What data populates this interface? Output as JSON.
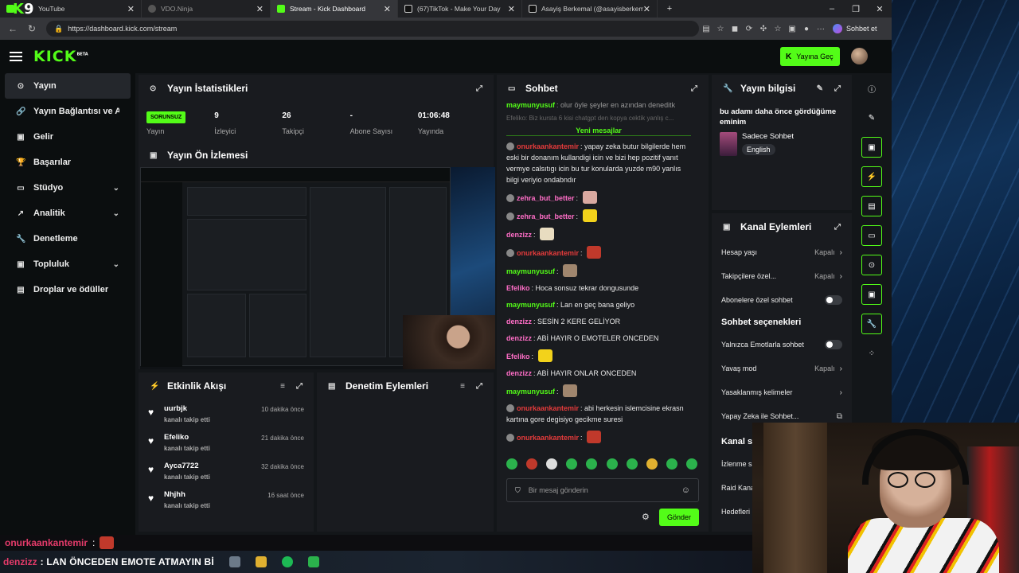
{
  "browser": {
    "tabs": [
      {
        "title": "YouTube",
        "color": "#ff0000"
      },
      {
        "title": "VDO.Ninja",
        "color": "#777777"
      },
      {
        "title": "Stream - Kick Dashboard",
        "color": "#53fc18"
      },
      {
        "title": "(67)TikTok - Make Your Day",
        "color": "#ffffff"
      },
      {
        "title": "Asayiş Berkemal (@asayisberkemal",
        "color": "#ffffff"
      }
    ],
    "url": "https://dashboard.kick.com/stream",
    "sohbet_et": "Sohbet et",
    "overlay_badge": "9"
  },
  "header": {
    "logo": "KICK",
    "logo_sup": "BETA",
    "go_live": "Yayına Geç"
  },
  "sidebar": {
    "items": [
      {
        "label": "Yayın",
        "icon": "target-icon",
        "active": true,
        "chevron": false
      },
      {
        "label": "Yayın Bağlantısı ve Anahtarı",
        "icon": "link-icon",
        "chevron": false
      },
      {
        "label": "Gelir",
        "icon": "wallet-icon",
        "chevron": false
      },
      {
        "label": "Başarılar",
        "icon": "trophy-icon",
        "chevron": false
      },
      {
        "label": "Stüdyo",
        "icon": "studio-icon",
        "chevron": true
      },
      {
        "label": "Analitik",
        "icon": "chart-icon",
        "chevron": true
      },
      {
        "label": "Denetleme",
        "icon": "wrench-icon",
        "chevron": false
      },
      {
        "label": "Topluluk",
        "icon": "community-icon",
        "chevron": true
      },
      {
        "label": "Droplar ve ödüller",
        "icon": "gift-icon",
        "chevron": false
      }
    ]
  },
  "stats": {
    "title": "Yayın İstatistikleri",
    "badge": "SORUNSUZ",
    "items": [
      {
        "value": "",
        "label": "Yayın"
      },
      {
        "value": "9",
        "label": "İzleyici"
      },
      {
        "value": "26",
        "label": "Takipçi"
      },
      {
        "value": "-",
        "label": "Abone Sayısı"
      },
      {
        "value": "01:06:48",
        "label": "Yayında"
      }
    ]
  },
  "preview": {
    "title": "Yayın Ön İzlemesi"
  },
  "activity": {
    "title": "Etkinlik Akışı",
    "items": [
      {
        "name": "uurbjk",
        "sub": "kanalı takip etti",
        "time": "10 dakika önce"
      },
      {
        "name": "Efeliko",
        "sub": "kanalı takip etti",
        "time": "21 dakika önce"
      },
      {
        "name": "Ayca7722",
        "sub": "kanalı takip etti",
        "time": "32 dakika önce"
      },
      {
        "name": "Nhjhh",
        "sub": "kanalı takip etti",
        "time": "16 saat önce"
      }
    ]
  },
  "moderation": {
    "title": "Denetim Eylemleri"
  },
  "chat": {
    "title": "Sohbet",
    "top_line_user": "maymunyusuf",
    "top_line_text": "olur öyle şeyler en azından deneditk",
    "faded": "Efeliko: Biz kursta 6 kisi chatgpt den kopya cektik yanlış c...",
    "new_messages": "Yeni mesajlar",
    "messages": [
      {
        "user": "onurkaankantemir",
        "color": "#e53b3b",
        "badge": true,
        "text": "yapay zeka butur bilgilerde hem eski bir donanım kullandigi icin ve bizi hep pozitif yanıt vermye calsıtıgı icin bu tur konularda yuzde m90 yanlıs bilgi veriyio ondabndır",
        "emote": ""
      },
      {
        "user": "zehra_but_better",
        "color": "#ff6ec7",
        "badge": true,
        "text": "",
        "emote": "#d9a9a0"
      },
      {
        "user": "zehra_but_better",
        "color": "#ff6ec7",
        "badge": true,
        "text": "",
        "emote": "#f2d21b"
      },
      {
        "user": "denzizz",
        "color": "#ff6ec7",
        "badge": false,
        "text": "",
        "emote": "#e8dcc0"
      },
      {
        "user": "onurkaankantemir",
        "color": "#e53b3b",
        "badge": true,
        "text": "",
        "emote": "#c0392b"
      },
      {
        "user": "maymunyusuf",
        "color": "#53fc18",
        "badge": false,
        "text": "",
        "emote": "#a0866e"
      },
      {
        "user": "Efeliko",
        "color": "#ff6ec7",
        "badge": false,
        "text": "Hoca sonsuz tekrar dongusunde",
        "emote": ""
      },
      {
        "user": "maymunyusuf",
        "color": "#53fc18",
        "badge": false,
        "text": "Lan en geç bana geliyo",
        "emote": ""
      },
      {
        "user": "denzizz",
        "color": "#ff6ec7",
        "badge": false,
        "text": "SESİN 2 KERE GELİYOR",
        "emote": ""
      },
      {
        "user": "denzizz",
        "color": "#ff6ec7",
        "badge": false,
        "text": "ABİ HAYIR O EMOTELER ONCEDEN",
        "emote": ""
      },
      {
        "user": "Efeliko",
        "color": "#ff6ec7",
        "badge": false,
        "text": "",
        "emote": "#f2d21b"
      },
      {
        "user": "denzizz",
        "color": "#ff6ec7",
        "badge": false,
        "text": "ABİ HAYIR ONLAR ONCEDEN",
        "emote": ""
      },
      {
        "user": "maymunyusuf",
        "color": "#53fc18",
        "badge": false,
        "text": "",
        "emote": "#a0866e"
      },
      {
        "user": "onurkaankantemir",
        "color": "#e53b3b",
        "badge": true,
        "text": "abi herkesin islemcisine ekrasn kartına gore degisiyo gecikme suresi",
        "emote": ""
      },
      {
        "user": "onurkaankantemir",
        "color": "#e53b3b",
        "badge": true,
        "text": "",
        "emote": "#c0392b"
      },
      {
        "user": "denzizz",
        "color": "#ff6ec7",
        "badge": false,
        "text": "LAN ÖNCEDEN EMOTE ATMAYIN Bİ",
        "emote": ""
      }
    ],
    "input_placeholder": "Bir mesaj gönderin",
    "send": "Gönder"
  },
  "stream_info": {
    "title": "Yayın bilgisi",
    "stream_title": "bu adamı daha önce gördüğüme eminim",
    "category": "Sadece Sohbet",
    "language": "English"
  },
  "channel_actions": {
    "title": "Kanal Eylemleri",
    "rows": [
      {
        "label": "Hesap yaşı",
        "value": "Kapalı",
        "type": "value"
      },
      {
        "label": "Takipçilere özel...",
        "value": "Kapalı",
        "type": "value"
      },
      {
        "label": "Abonelere özel sohbet",
        "value": "",
        "type": "toggle"
      }
    ],
    "chat_options_title": "Sohbet seçenekleri",
    "chat_rows": [
      {
        "label": "Yalnızca Emotlarla sohbet",
        "value": "",
        "type": "toggle"
      },
      {
        "label": "Yavaş mod",
        "value": "Kapalı",
        "type": "value"
      },
      {
        "label": "Yasaklanmış kelimeler",
        "value": "",
        "type": "arrow"
      },
      {
        "label": "Yapay Zeka ile Sohbet...",
        "value": "",
        "type": "external"
      }
    ],
    "cut_section": "Kanal se",
    "cut_rows": [
      "İzlenme sa",
      "Raid Kana",
      "Hedefleri"
    ]
  },
  "overlay": {
    "user": "onurkaankantemir",
    "colon": ":"
  },
  "taskbar": {
    "user": "denzizz",
    "message": ": LAN ÖNCEDEN EMOTE ATMAYIN Bİ"
  }
}
